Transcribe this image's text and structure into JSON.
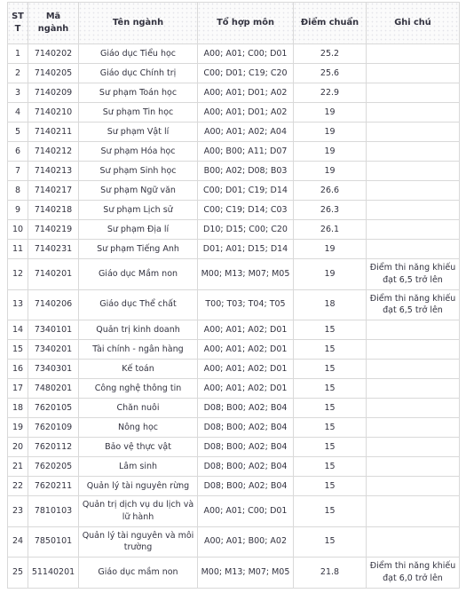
{
  "table": {
    "columns": [
      {
        "key": "stt",
        "label": "STT"
      },
      {
        "key": "code",
        "label": "Mã ngành"
      },
      {
        "key": "name",
        "label": "Tên ngành"
      },
      {
        "key": "comb",
        "label": "Tổ hợp môn"
      },
      {
        "key": "score",
        "label": "Điểm chuẩn"
      },
      {
        "key": "note",
        "label": "Ghi chú"
      }
    ],
    "rows": [
      {
        "stt": "1",
        "code": "7140202",
        "name": "Giáo dục Tiểu học",
        "comb": "A00; A01; C00; D01",
        "score": "25.2",
        "note": ""
      },
      {
        "stt": "2",
        "code": "7140205",
        "name": "Giáo dục Chính trị",
        "comb": "C00; D01; C19; C20",
        "score": "25.6",
        "note": ""
      },
      {
        "stt": "3",
        "code": "7140209",
        "name": "Sư phạm Toán học",
        "comb": "A00; A01; D01; A02",
        "score": "22.9",
        "note": ""
      },
      {
        "stt": "4",
        "code": "7140210",
        "name": "Sư phạm Tin học",
        "comb": "A00; A01; D01; A02",
        "score": "19",
        "note": ""
      },
      {
        "stt": "5",
        "code": "7140211",
        "name": "Sư phạm Vật lí",
        "comb": "A00; A01; A02; A04",
        "score": "19",
        "note": ""
      },
      {
        "stt": "6",
        "code": "7140212",
        "name": "Sư phạm Hóa học",
        "comb": "A00; B00; A11; D07",
        "score": "19",
        "note": ""
      },
      {
        "stt": "7",
        "code": "7140213",
        "name": "Sư phạm Sinh học",
        "comb": "B00; A02; D08; B03",
        "score": "19",
        "note": ""
      },
      {
        "stt": "8",
        "code": "7140217",
        "name": "Sư phạm Ngữ văn",
        "comb": "C00; D01; C19; D14",
        "score": "26.6",
        "note": ""
      },
      {
        "stt": "9",
        "code": "7140218",
        "name": "Sư phạm Lịch sử",
        "comb": "C00; C19; D14; C03",
        "score": "26.3",
        "note": ""
      },
      {
        "stt": "10",
        "code": "7140219",
        "name": "Sư phạm Địa lí",
        "comb": "D10; D15; C00; C20",
        "score": "26.1",
        "note": ""
      },
      {
        "stt": "11",
        "code": "7140231",
        "name": "Sư phạm Tiếng Anh",
        "comb": "D01; A01; D15; D14",
        "score": "19",
        "note": ""
      },
      {
        "stt": "12",
        "code": "7140201",
        "name": "Giáo dục Mầm non",
        "comb": "M00; M13; M07; M05",
        "score": "19",
        "note": "Điểm thi năng khiếu đạt 6,5 trở lên"
      },
      {
        "stt": "13",
        "code": "7140206",
        "name": "Giáo dục Thể chất",
        "comb": "T00; T03; T04; T05",
        "score": "18",
        "note": "Điểm thi năng khiếu đạt 6,5 trở lên"
      },
      {
        "stt": "14",
        "code": "7340101",
        "name": "Quản trị kinh doanh",
        "comb": "A00; A01; A02; D01",
        "score": "15",
        "note": ""
      },
      {
        "stt": "15",
        "code": "7340201",
        "name": "Tài chính - ngân hàng",
        "comb": "A00; A01; A02; D01",
        "score": "15",
        "note": ""
      },
      {
        "stt": "16",
        "code": "7340301",
        "name": "Kế toán",
        "comb": "A00; A01; A02; D01",
        "score": "15",
        "note": ""
      },
      {
        "stt": "17",
        "code": "7480201",
        "name": "Công nghệ thông tin",
        "comb": "A00; A01; A02; D01",
        "score": "15",
        "note": ""
      },
      {
        "stt": "18",
        "code": "7620105",
        "name": "Chăn nuôi",
        "comb": "D08; B00; A02; B04",
        "score": "15",
        "note": ""
      },
      {
        "stt": "19",
        "code": "7620109",
        "name": "Nông học",
        "comb": "D08; B00; A02; B04",
        "score": "15",
        "note": ""
      },
      {
        "stt": "20",
        "code": "7620112",
        "name": "Bảo vệ thực vật",
        "comb": "D08; B00; A02; B04",
        "score": "15",
        "note": ""
      },
      {
        "stt": "21",
        "code": "7620205",
        "name": "Lâm sinh",
        "comb": "D08; B00; A02; B04",
        "score": "15",
        "note": ""
      },
      {
        "stt": "22",
        "code": "7620211",
        "name": "Quản lý tài nguyên rừng",
        "comb": "D08; B00; A02; B04",
        "score": "15",
        "note": ""
      },
      {
        "stt": "23",
        "code": "7810103",
        "name": "Quản trị dịch vụ du lịch và lữ hành",
        "comb": "A00; A01; C00; D01",
        "score": "15",
        "note": ""
      },
      {
        "stt": "24",
        "code": "7850101",
        "name": "Quản lý tài nguyên và môi trường",
        "comb": "A00; A01; B00; A02",
        "score": "15",
        "note": ""
      },
      {
        "stt": "25",
        "code": "51140201",
        "name": "Giáo dục mầm non",
        "comb": "M00; M13; M07; M05",
        "score": "21.8",
        "note": "Điểm thi năng khiếu đạt 6,0 trở lên"
      }
    ]
  }
}
